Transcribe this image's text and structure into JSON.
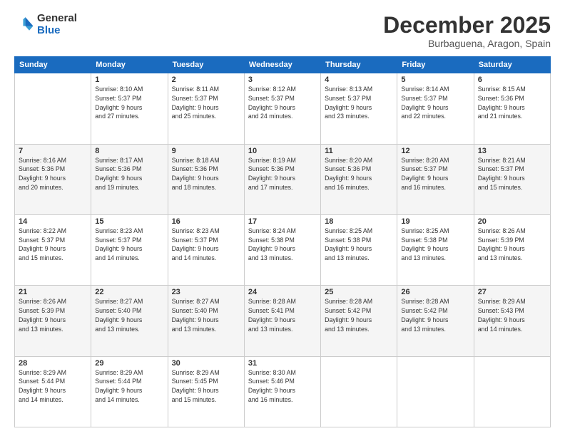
{
  "logo": {
    "general": "General",
    "blue": "Blue"
  },
  "header": {
    "month": "December 2025",
    "location": "Burbaguena, Aragon, Spain"
  },
  "weekdays": [
    "Sunday",
    "Monday",
    "Tuesday",
    "Wednesday",
    "Thursday",
    "Friday",
    "Saturday"
  ],
  "weeks": [
    [
      {
        "day": "",
        "info": ""
      },
      {
        "day": "1",
        "info": "Sunrise: 8:10 AM\nSunset: 5:37 PM\nDaylight: 9 hours\nand 27 minutes."
      },
      {
        "day": "2",
        "info": "Sunrise: 8:11 AM\nSunset: 5:37 PM\nDaylight: 9 hours\nand 25 minutes."
      },
      {
        "day": "3",
        "info": "Sunrise: 8:12 AM\nSunset: 5:37 PM\nDaylight: 9 hours\nand 24 minutes."
      },
      {
        "day": "4",
        "info": "Sunrise: 8:13 AM\nSunset: 5:37 PM\nDaylight: 9 hours\nand 23 minutes."
      },
      {
        "day": "5",
        "info": "Sunrise: 8:14 AM\nSunset: 5:37 PM\nDaylight: 9 hours\nand 22 minutes."
      },
      {
        "day": "6",
        "info": "Sunrise: 8:15 AM\nSunset: 5:36 PM\nDaylight: 9 hours\nand 21 minutes."
      }
    ],
    [
      {
        "day": "7",
        "info": "Sunrise: 8:16 AM\nSunset: 5:36 PM\nDaylight: 9 hours\nand 20 minutes."
      },
      {
        "day": "8",
        "info": "Sunrise: 8:17 AM\nSunset: 5:36 PM\nDaylight: 9 hours\nand 19 minutes."
      },
      {
        "day": "9",
        "info": "Sunrise: 8:18 AM\nSunset: 5:36 PM\nDaylight: 9 hours\nand 18 minutes."
      },
      {
        "day": "10",
        "info": "Sunrise: 8:19 AM\nSunset: 5:36 PM\nDaylight: 9 hours\nand 17 minutes."
      },
      {
        "day": "11",
        "info": "Sunrise: 8:20 AM\nSunset: 5:36 PM\nDaylight: 9 hours\nand 16 minutes."
      },
      {
        "day": "12",
        "info": "Sunrise: 8:20 AM\nSunset: 5:37 PM\nDaylight: 9 hours\nand 16 minutes."
      },
      {
        "day": "13",
        "info": "Sunrise: 8:21 AM\nSunset: 5:37 PM\nDaylight: 9 hours\nand 15 minutes."
      }
    ],
    [
      {
        "day": "14",
        "info": "Sunrise: 8:22 AM\nSunset: 5:37 PM\nDaylight: 9 hours\nand 15 minutes."
      },
      {
        "day": "15",
        "info": "Sunrise: 8:23 AM\nSunset: 5:37 PM\nDaylight: 9 hours\nand 14 minutes."
      },
      {
        "day": "16",
        "info": "Sunrise: 8:23 AM\nSunset: 5:37 PM\nDaylight: 9 hours\nand 14 minutes."
      },
      {
        "day": "17",
        "info": "Sunrise: 8:24 AM\nSunset: 5:38 PM\nDaylight: 9 hours\nand 13 minutes."
      },
      {
        "day": "18",
        "info": "Sunrise: 8:25 AM\nSunset: 5:38 PM\nDaylight: 9 hours\nand 13 minutes."
      },
      {
        "day": "19",
        "info": "Sunrise: 8:25 AM\nSunset: 5:38 PM\nDaylight: 9 hours\nand 13 minutes."
      },
      {
        "day": "20",
        "info": "Sunrise: 8:26 AM\nSunset: 5:39 PM\nDaylight: 9 hours\nand 13 minutes."
      }
    ],
    [
      {
        "day": "21",
        "info": "Sunrise: 8:26 AM\nSunset: 5:39 PM\nDaylight: 9 hours\nand 13 minutes."
      },
      {
        "day": "22",
        "info": "Sunrise: 8:27 AM\nSunset: 5:40 PM\nDaylight: 9 hours\nand 13 minutes."
      },
      {
        "day": "23",
        "info": "Sunrise: 8:27 AM\nSunset: 5:40 PM\nDaylight: 9 hours\nand 13 minutes."
      },
      {
        "day": "24",
        "info": "Sunrise: 8:28 AM\nSunset: 5:41 PM\nDaylight: 9 hours\nand 13 minutes."
      },
      {
        "day": "25",
        "info": "Sunrise: 8:28 AM\nSunset: 5:42 PM\nDaylight: 9 hours\nand 13 minutes."
      },
      {
        "day": "26",
        "info": "Sunrise: 8:28 AM\nSunset: 5:42 PM\nDaylight: 9 hours\nand 13 minutes."
      },
      {
        "day": "27",
        "info": "Sunrise: 8:29 AM\nSunset: 5:43 PM\nDaylight: 9 hours\nand 14 minutes."
      }
    ],
    [
      {
        "day": "28",
        "info": "Sunrise: 8:29 AM\nSunset: 5:44 PM\nDaylight: 9 hours\nand 14 minutes."
      },
      {
        "day": "29",
        "info": "Sunrise: 8:29 AM\nSunset: 5:44 PM\nDaylight: 9 hours\nand 14 minutes."
      },
      {
        "day": "30",
        "info": "Sunrise: 8:29 AM\nSunset: 5:45 PM\nDaylight: 9 hours\nand 15 minutes."
      },
      {
        "day": "31",
        "info": "Sunrise: 8:30 AM\nSunset: 5:46 PM\nDaylight: 9 hours\nand 16 minutes."
      },
      {
        "day": "",
        "info": ""
      },
      {
        "day": "",
        "info": ""
      },
      {
        "day": "",
        "info": ""
      }
    ]
  ]
}
